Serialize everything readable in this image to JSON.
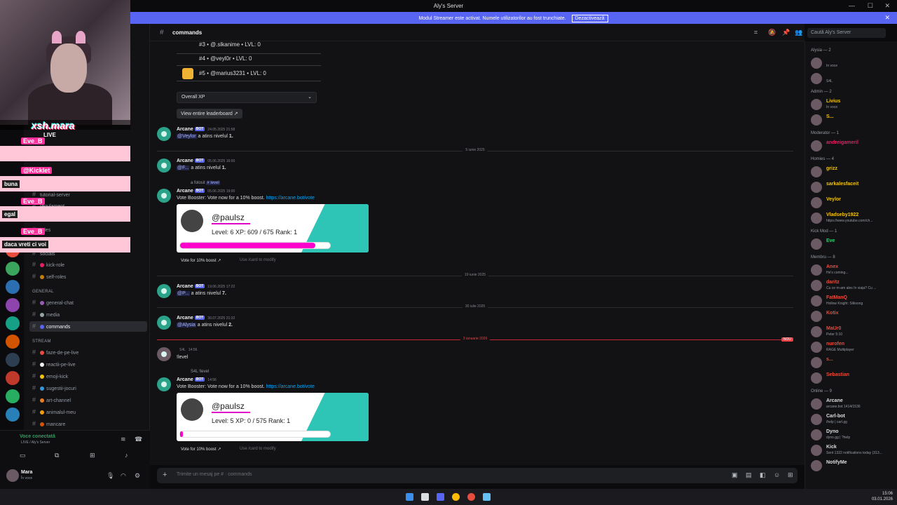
{
  "window": {
    "title": "Aly's Server"
  },
  "banner": {
    "text": "Modul Streamer este activat. Numele utilizatorilor au fost trunchiate.",
    "button": "Dezactivează"
  },
  "header": {
    "channel": "commands",
    "search_placeholder": "Caută Aly's Server"
  },
  "stream": {
    "tiktok_name": "xsh.mara",
    "live": "LIVE",
    "chat": [
      {
        "name": "Eve_B",
        "msg": ""
      },
      {
        "name": "@Kicklet",
        "msg": "buna"
      },
      {
        "name": "Eve_B",
        "msg": "egal"
      },
      {
        "name": "Eve_B",
        "msg": "daca vreti ci voi"
      }
    ]
  },
  "sidebar": {
    "categories": {
      "general": "GENERAL",
      "stream": "STREAM"
    },
    "channels": [
      {
        "name": "tutorial-server"
      },
      {
        "name": "regulament"
      },
      {
        "name": "roles"
      },
      {
        "name": "socials"
      },
      {
        "name": "kick-role"
      },
      {
        "name": "self-roles"
      },
      {
        "name": "general-chat"
      },
      {
        "name": "media"
      },
      {
        "name": "commands"
      },
      {
        "name": "faze-de-pe-live"
      },
      {
        "name": "reactii-pe-live"
      },
      {
        "name": "emoji-kick"
      },
      {
        "name": "sugestii-jocuri"
      },
      {
        "name": "art-channel"
      },
      {
        "name": "animalul-meu"
      },
      {
        "name": "mancare"
      }
    ],
    "voice": {
      "status": "Voce conectată",
      "server": "LIVE / Aly's Server"
    },
    "user": {
      "name": "Mara",
      "status": "În voce"
    }
  },
  "leaderboard": {
    "rows": [
      "#3 • @.slkanime • LVL: 0",
      "#4 • @veyl0r • LVL: 0",
      "#5 • @marius3231 • LVL: 0"
    ],
    "select": "Overall XP",
    "view_btn": "View entire leaderboard"
  },
  "messages": {
    "m1": {
      "author": "Arcane",
      "bot": "BOT",
      "time": "24.05.2025 21:58",
      "mention": "@Veylor",
      "text": " a atins nivelul ",
      "level": "1."
    },
    "sep1": "5 iunie 2025",
    "m2": {
      "author": "Arcane",
      "bot": "BOT",
      "time": "05.06.2025 16:00",
      "mention": "@F...",
      "text": " a atins nivelul ",
      "level": "1."
    },
    "m3": {
      "reply": "a folosit",
      "reply_cmd": "# level",
      "author": "Arcane",
      "bot": "BOT",
      "time": "05.06.2025 19:00",
      "text": "Vote Booster: Vote now for a 10% boost. ",
      "link": "https://arcane.bot/vote",
      "card": {
        "user": "@paulsz",
        "stats": "Level: 6   XP: 609 / 675   Rank: 1",
        "progress": 0.9
      },
      "btn1": "Vote for 10% boost",
      "btn2": "Use /card to modify"
    },
    "sep2": "19 iunie 2025",
    "m4": {
      "author": "Arcane",
      "bot": "BOT",
      "time": "19.06.2025 17:22",
      "mention": "@P...",
      "text": " a atins nivelul ",
      "level": "7."
    },
    "sep3": "30 iulie 2025",
    "m5": {
      "author": "Arcane",
      "bot": "BOT",
      "time": "30.07.2025 21:32",
      "mention": "@Alysia",
      "text": " a atins nivelul ",
      "level": "2."
    },
    "sep_new": "3 ianuarie 2026",
    "new_tag": "NOU",
    "m6": {
      "author": "",
      "tag": "S4L",
      "time": "14:56",
      "text": "!level"
    },
    "m7": {
      "reply": "S4L",
      "reply_cmd": "!level",
      "author": "Arcane",
      "bot": "BOT",
      "time": "14:56",
      "text": "Vote Booster: Vote now for a 10% boost. ",
      "link": "https://arcane.bot/vote",
      "card": {
        "user": "@paulsz",
        "stats": "Level: 5   XP: 0 / 575   Rank: 1",
        "progress": 0.02
      },
      "btn1": "Vote for 10% boost",
      "btn2": "Use /card to modify"
    }
  },
  "composer": {
    "placeholder": "Trimite un mesaj pe # · commands"
  },
  "members": {
    "groups": [
      {
        "title": "Alysia — 2",
        "members": [
          {
            "name": "",
            "status": "În voce",
            "color": "#dbdee1"
          },
          {
            "name": "",
            "status": "S4L",
            "color": "#dbdee1"
          }
        ]
      },
      {
        "title": "Admin — 2",
        "members": [
          {
            "name": "Livius",
            "status": "În voce",
            "color": "#f1c40f"
          },
          {
            "name": "S...",
            "status": "",
            "color": "#f1c40f"
          }
        ]
      },
      {
        "title": "Moderator — 1",
        "members": [
          {
            "name": "andreigameril",
            "status": "",
            "color": "#e91e63"
          }
        ]
      },
      {
        "title": "Homies — 4",
        "members": [
          {
            "name": "grizz",
            "status": "",
            "color": "#f1c40f"
          },
          {
            "name": "sarkalesfaceit",
            "status": "",
            "color": "#f1c40f"
          },
          {
            "name": "Veylor",
            "status": "",
            "color": "#f1c40f"
          },
          {
            "name": "Vladseby1922",
            "status": "https://www.youtube.com/ch...",
            "color": "#f1c40f"
          }
        ]
      },
      {
        "title": "Kick Mod — 1",
        "members": [
          {
            "name": "Eve",
            "status": "",
            "color": "#2ecc71"
          }
        ]
      },
      {
        "title": "Membru — 8",
        "members": [
          {
            "name": "Anex",
            "status": "He's coming...",
            "color": "#e74c3c"
          },
          {
            "name": "daritz",
            "status": "Cu ce m-am ales în viața? Cu ...",
            "color": "#e74c3c"
          },
          {
            "name": "FatManQ",
            "status": "Hollow Knight: Silksong",
            "color": "#e74c3c"
          },
          {
            "name": "Kotix",
            "status": "",
            "color": "#e74c3c"
          },
          {
            "name": "MaUr0",
            "status": "Peter 5:10",
            "color": "#e74c3c"
          },
          {
            "name": "nurofen",
            "status": "RAGE Multiplayer",
            "color": "#e74c3c"
          },
          {
            "name": "s...",
            "status": "",
            "color": "#e74c3c"
          },
          {
            "name": "Sebastian",
            "status": "",
            "color": "#e74c3c"
          }
        ]
      },
      {
        "title": "Online — 9",
        "members": [
          {
            "name": "Arcane",
            "status": "arcane.bot 1414/1536",
            "color": "#dbdee1"
          },
          {
            "name": "Carl-bot",
            "status": "/help | carl.gg",
            "color": "#dbdee1"
          },
          {
            "name": "Dyno",
            "status": "dyno.gg | ?help",
            "color": "#dbdee1"
          },
          {
            "name": "Kick",
            "status": "Sent 1322 notifications today (313...",
            "color": "#dbdee1"
          },
          {
            "name": "NotifyMe",
            "status": "",
            "color": "#dbdee1"
          }
        ]
      }
    ]
  },
  "taskbar": {
    "time": "15:06",
    "date": "03.01.2026"
  },
  "colors": {
    "accent": "#5865f2",
    "teal": "#2ec4b6",
    "pink": "#ff00cc"
  }
}
